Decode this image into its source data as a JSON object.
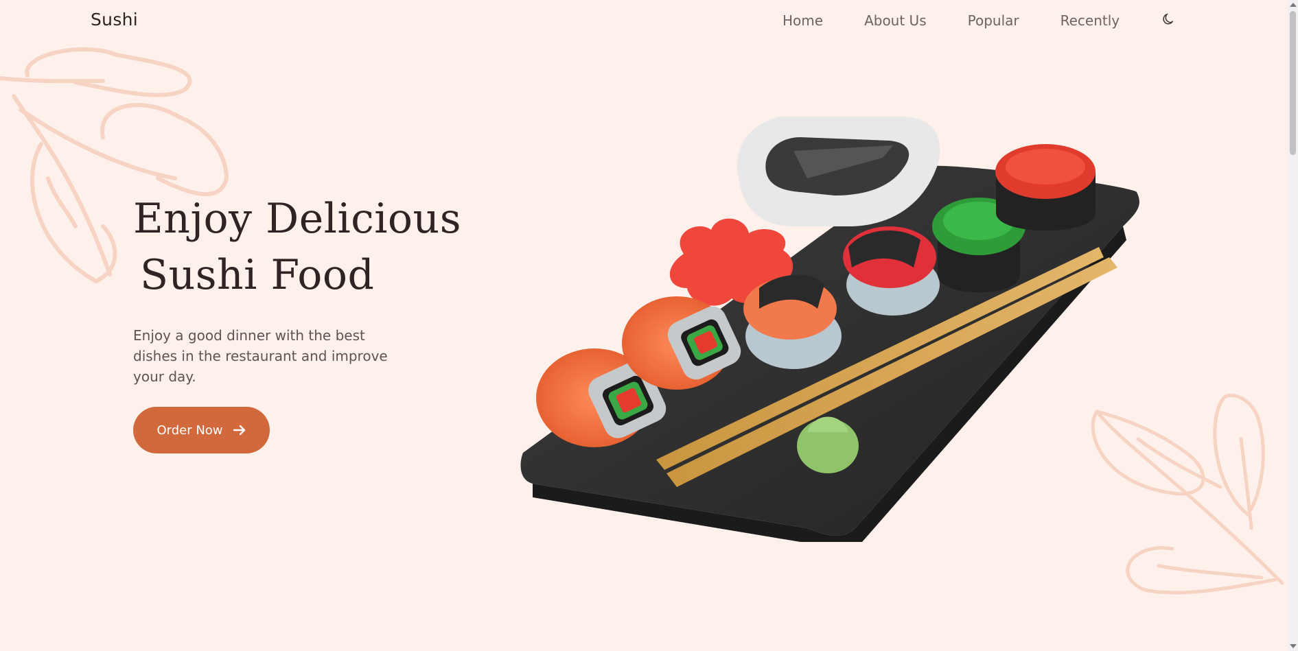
{
  "header": {
    "logo": "Sushi",
    "nav": [
      "Home",
      "About Us",
      "Popular",
      "Recently"
    ],
    "theme_icon": "moon-icon"
  },
  "hero": {
    "title_line1": "Enjoy Delicious",
    "title_line2": "Sushi Food",
    "description": "Enjoy a good dinner with the best dishes in the restaurant and improve your day.",
    "cta_label": "Order Now",
    "cta_icon": "arrow-right-icon"
  },
  "colors": {
    "background": "#fef1eb",
    "accent": "#d2693d",
    "heading": "#2e2424",
    "text": "#5c5454",
    "leaf": "#f6d3c3"
  }
}
